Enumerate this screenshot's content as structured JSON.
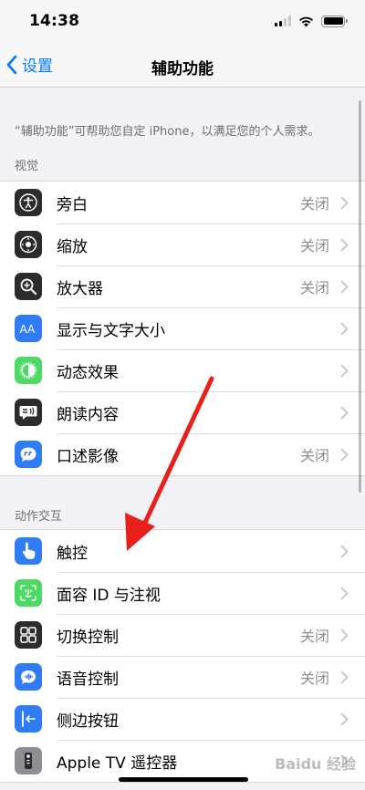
{
  "status": {
    "time": "14:38"
  },
  "nav": {
    "back_label": "设置",
    "title": "辅助功能"
  },
  "description": "“辅助功能”可帮助您自定 iPhone，以满足您的个人需求。",
  "sections": [
    {
      "header": "视觉",
      "rows": [
        {
          "label": "旁白",
          "value": "关闭",
          "icon": "voiceover-icon",
          "color": "#2c2c2e"
        },
        {
          "label": "缩放",
          "value": "关闭",
          "icon": "zoom-icon",
          "color": "#2c2c2e"
        },
        {
          "label": "放大器",
          "value": "关闭",
          "icon": "magnifier-icon",
          "color": "#2c2c2e"
        },
        {
          "label": "显示与文字大小",
          "value": "",
          "icon": "text-size-icon",
          "color": "#2f7cf6"
        },
        {
          "label": "动态效果",
          "value": "",
          "icon": "motion-icon",
          "color": "#4cd964"
        },
        {
          "label": "朗读内容",
          "value": "",
          "icon": "spoken-content-icon",
          "color": "#2c2c2e"
        },
        {
          "label": "口述影像",
          "value": "关闭",
          "icon": "audio-description-icon",
          "color": "#2f7cf6"
        }
      ]
    },
    {
      "header": "动作交互",
      "rows": [
        {
          "label": "触控",
          "value": "",
          "icon": "touch-icon",
          "color": "#2f7cf6"
        },
        {
          "label": "面容 ID 与注视",
          "value": "",
          "icon": "face-id-icon",
          "color": "#4cd964"
        },
        {
          "label": "切换控制",
          "value": "关闭",
          "icon": "switch-control-icon",
          "color": "#2c2c2e"
        },
        {
          "label": "语音控制",
          "value": "关闭",
          "icon": "voice-control-icon",
          "color": "#2f7cf6"
        },
        {
          "label": "侧边按钮",
          "value": "",
          "icon": "side-button-icon",
          "color": "#2f7cf6"
        },
        {
          "label": "Apple TV 遥控器",
          "value": "",
          "icon": "apple-tv-remote-icon",
          "color": "#8e8e93"
        }
      ]
    }
  ],
  "watermark": "Baidu 经验"
}
